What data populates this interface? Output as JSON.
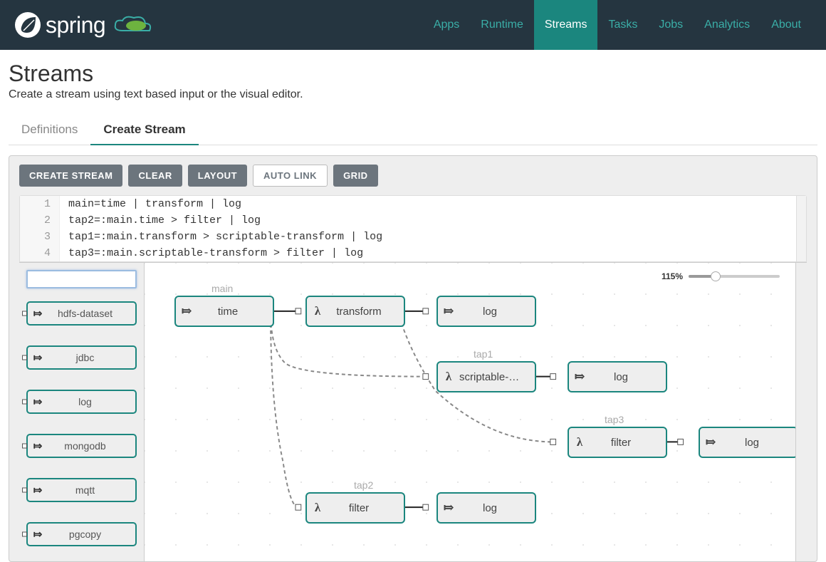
{
  "brand": "spring",
  "nav": [
    {
      "label": "Apps",
      "active": false
    },
    {
      "label": "Runtime",
      "active": false
    },
    {
      "label": "Streams",
      "active": true
    },
    {
      "label": "Tasks",
      "active": false
    },
    {
      "label": "Jobs",
      "active": false
    },
    {
      "label": "Analytics",
      "active": false
    },
    {
      "label": "About",
      "active": false
    }
  ],
  "page": {
    "title": "Streams",
    "subtitle": "Create a stream using text based input or the visual editor."
  },
  "tabs": [
    {
      "label": "Definitions",
      "active": false
    },
    {
      "label": "Create Stream",
      "active": true
    }
  ],
  "toolbar": {
    "create": "CREATE STREAM",
    "clear": "CLEAR",
    "layout": "LAYOUT",
    "autolink": "AUTO LINK",
    "grid": "GRID"
  },
  "code": {
    "lines": [
      "main=time | transform | log",
      "tap2=:main.time > filter | log",
      "tap1=:main.transform > scriptable-transform | log",
      "tap3=:main.scriptable-transform > filter | log"
    ]
  },
  "palette": {
    "search": "",
    "items": [
      "hdfs-dataset",
      "jdbc",
      "log",
      "mongodb",
      "mqtt",
      "pgcopy"
    ]
  },
  "zoom": "115%",
  "streams": {
    "main": {
      "label": "main"
    },
    "tap1": {
      "label": "tap1"
    },
    "tap2": {
      "label": "tap2"
    },
    "tap3": {
      "label": "tap3"
    }
  },
  "nodes": {
    "time": {
      "label": "time",
      "icon": "arrow"
    },
    "transform": {
      "label": "transform",
      "icon": "lambda"
    },
    "log1": {
      "label": "log",
      "icon": "arrow"
    },
    "scriptable": {
      "label": "scriptable-tra…",
      "icon": "lambda"
    },
    "log2": {
      "label": "log",
      "icon": "arrow"
    },
    "filter3": {
      "label": "filter",
      "icon": "lambda"
    },
    "log3": {
      "label": "log",
      "icon": "arrow"
    },
    "filter2": {
      "label": "filter",
      "icon": "lambda"
    },
    "log4": {
      "label": "log",
      "icon": "arrow"
    }
  }
}
